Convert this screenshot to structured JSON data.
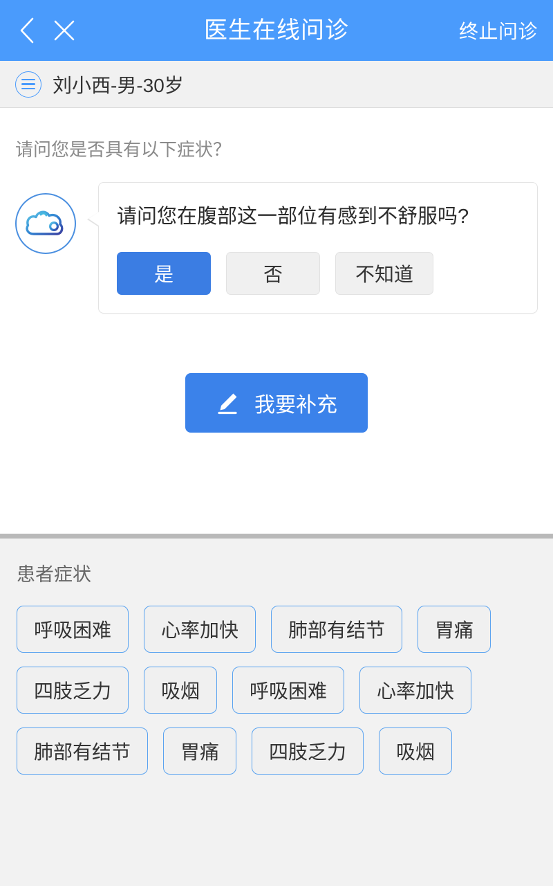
{
  "topbar": {
    "back_icon": "chevron-left-icon",
    "close_icon": "close-icon",
    "title": "医生在线问诊",
    "action_label": "终止问诊",
    "background_color": "#4a9bfc",
    "text_color": "#ffffff"
  },
  "patient_bar": {
    "menu_icon": "hamburger-menu-icon",
    "patient_info": "刘小西-男-30岁",
    "background_color": "#f1f1f1"
  },
  "chat": {
    "prompt": "请问您是否具有以下症状？",
    "avatar_icon": "clinic-cloud-logo-icon",
    "message": {
      "text": "请问您在腹部这一部位有感到不舒服吗?",
      "answers": [
        {
          "label": "是",
          "selected": true
        },
        {
          "label": "否",
          "selected": false
        },
        {
          "label": "不知道",
          "selected": false
        }
      ]
    },
    "supplement_button": {
      "icon": "pencil-edit-icon",
      "label": "我要补充",
      "color": "#3b82ea"
    }
  },
  "symptoms": {
    "title": "患者症状",
    "border_color": "#5aa3f0",
    "tags": [
      "呼吸困难",
      "心率加快",
      "肺部有结节",
      "胃痛",
      "四肢乏力",
      "吸烟",
      "呼吸困难",
      "心率加快",
      "肺部有结节",
      "胃痛",
      "四肢乏力",
      "吸烟"
    ]
  }
}
